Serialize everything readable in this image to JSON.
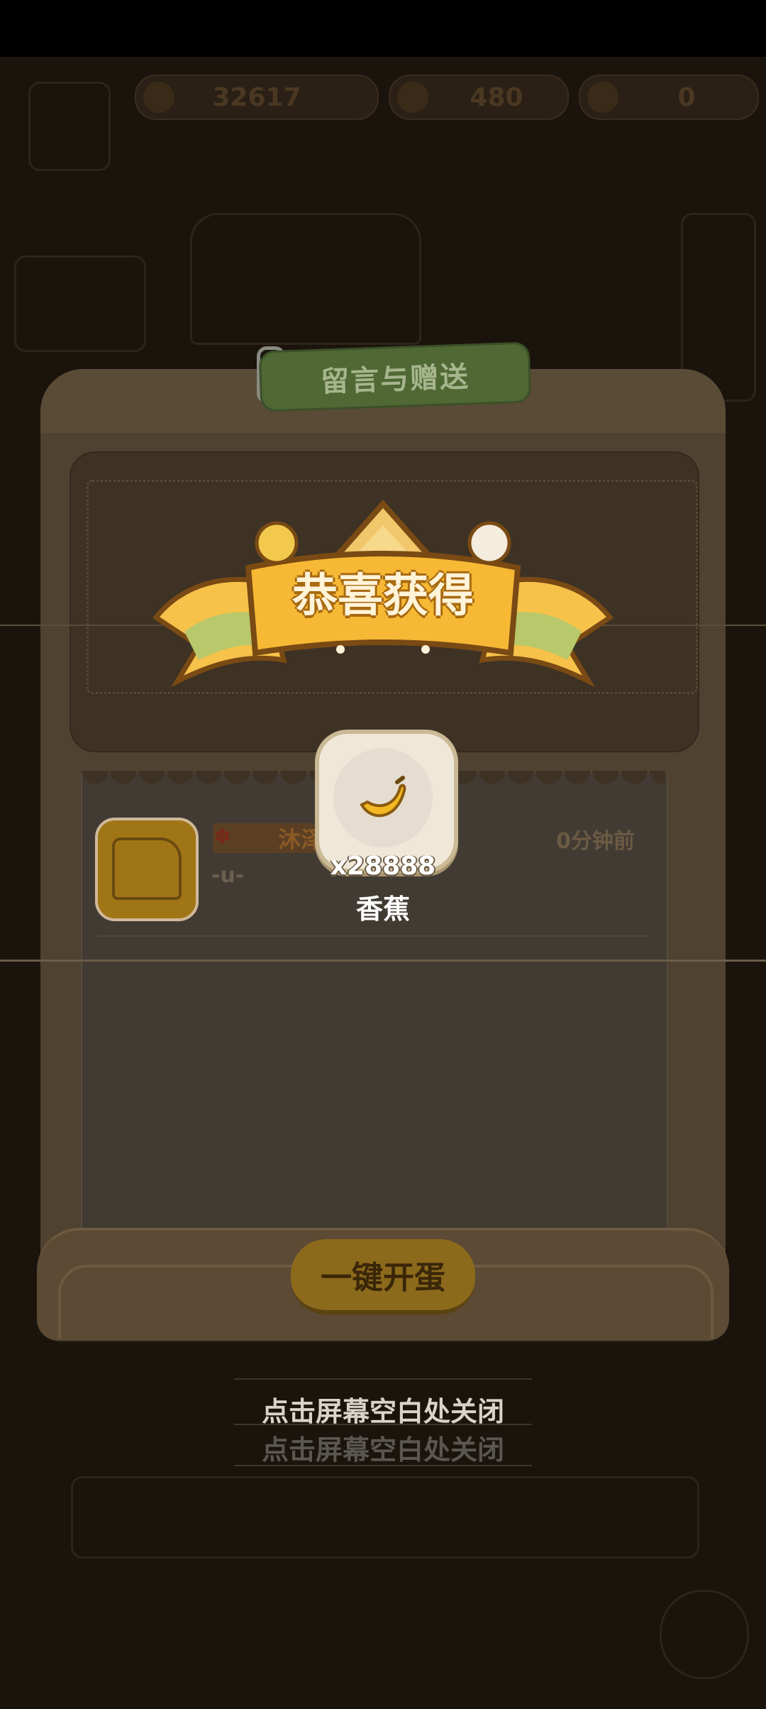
{
  "resources": [
    {
      "icon": "banana-icon",
      "value": "32617"
    },
    {
      "icon": "gem-icon",
      "value": "480"
    },
    {
      "icon": "carrot-icon",
      "value": "0"
    }
  ],
  "modal": {
    "tab_label": "留言与赠送",
    "message": {
      "name": "沐泽",
      "text": "-u-",
      "time": "0分钟前"
    },
    "open_all_button": "一键开蛋"
  },
  "reward": {
    "title": "恭喜获得",
    "item_icon": "banana-icon",
    "quantity": "x28888",
    "item_name": "香蕉"
  },
  "close_hint": "点击屏幕空白处关闭",
  "colors": {
    "banner_gold": "#f5b938",
    "tab_green": "#4f6834",
    "panel_brown": "#4f4230"
  }
}
